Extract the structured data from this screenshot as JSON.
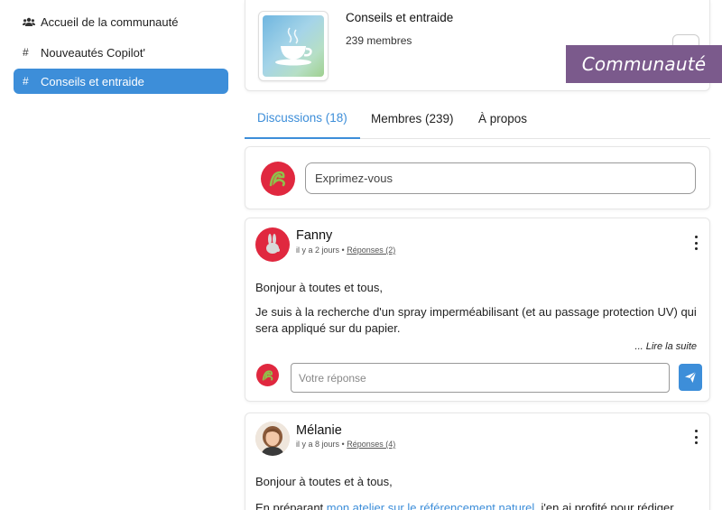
{
  "sidebar": {
    "items": [
      {
        "label": "Accueil de la communauté",
        "icon": "users-icon",
        "active": false
      },
      {
        "label": "Nouveautés Copilot'",
        "icon": "hash-icon",
        "active": false
      },
      {
        "label": "Conseils et entraide",
        "icon": "hash-icon",
        "active": true
      }
    ]
  },
  "group": {
    "name": "Conseils et entraide",
    "members": "239 membres",
    "thumbnail_icon": "coffee-cup-icon"
  },
  "tabs": [
    {
      "label": "Discussions (18)",
      "active": true
    },
    {
      "label": "Membres (239)",
      "active": false
    },
    {
      "label": "À propos",
      "active": false
    }
  ],
  "composer": {
    "placeholder": "Exprimez-vous"
  },
  "posts": [
    {
      "author": "Fanny",
      "time": "il y a 2 jours",
      "separator": "•",
      "replies": "Réponses (2)",
      "avatar": "rabbit-avatar",
      "paragraph1": "Bonjour à toutes et tous,",
      "paragraph2": "Je suis à la recherche d'un spray imperméabilisant (et au passage protection UV) qui sera appliqué sur du papier.",
      "read_more": "... Lire la suite",
      "reply_placeholder": "Votre réponse"
    },
    {
      "author": "Mélanie",
      "time": "il y a 8 jours",
      "separator": "•",
      "replies": "Réponses (4)",
      "avatar": "person-avatar",
      "paragraph1": "Bonjour à toutes et à tous,",
      "paragraph2_start": "En préparant ",
      "paragraph2_link": "mon atelier sur le référencement naturel",
      "paragraph2_end": ", j'en ai profité pour rédiger"
    }
  ],
  "banner": {
    "label": "Communauté"
  },
  "colors": {
    "accent": "#3d8ed9",
    "brand_red": "#e0283f",
    "banner": "#7b5a8c"
  }
}
